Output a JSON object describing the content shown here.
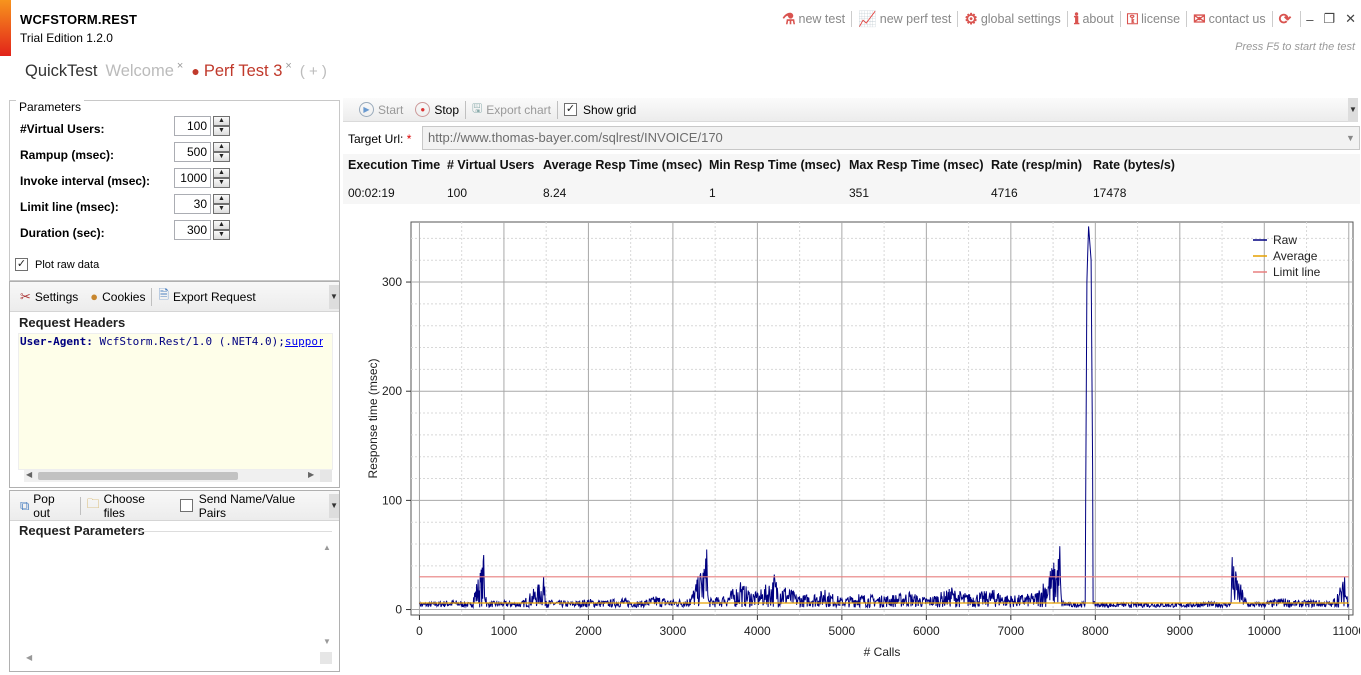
{
  "app": {
    "title": "WCFSTORM.REST",
    "edition": "Trial Edition 1.2.0",
    "hint": "Press F5 to start the test"
  },
  "menu": {
    "new_test": "new test",
    "new_perf_test": "new perf test",
    "global_settings": "global settings",
    "about": "about",
    "license": "license",
    "contact_us": "contact us"
  },
  "tabs": {
    "quicktest": "QuickTest",
    "welcome": "Welcome",
    "perf_test": "Perf Test 3",
    "add": "( + )",
    "close_glyph": "×"
  },
  "parameters": {
    "title": "Parameters",
    "items": [
      {
        "label": "#Virtual Users:",
        "value": "100"
      },
      {
        "label": "Rampup (msec):",
        "value": "500"
      },
      {
        "label": "Invoke interval (msec):",
        "value": "1000"
      },
      {
        "label": "Limit line (msec):",
        "value": "30"
      },
      {
        "label": "Duration (sec):",
        "value": "300"
      }
    ],
    "plot_raw_label": "Plot raw data",
    "plot_raw_checked": true
  },
  "headers_panel": {
    "settings": "Settings",
    "cookies": "Cookies",
    "export_request": "Export Request",
    "title": "Request Headers",
    "header_key": "User-Agent:",
    "header_value": " WcfStorm.Rest/1.0 (.NET4.0);",
    "header_link": "support"
  },
  "params_panel": {
    "pop_out": "Pop out",
    "choose_files": "Choose files",
    "send_pairs": "Send Name/Value Pairs",
    "title": "Request Parameters"
  },
  "run_toolbar": {
    "start": "Start",
    "stop": "Stop",
    "export_chart": "Export chart",
    "show_grid": "Show grid",
    "show_grid_checked": true
  },
  "target": {
    "label": "Target Url:",
    "required_mark": "*",
    "url": "http://www.thomas-bayer.com/sqlrest/INVOICE/170"
  },
  "stats": {
    "headers": [
      "Execution Time",
      "# Virtual Users",
      "Average Resp Time (msec)",
      "Min Resp Time (msec)",
      "Max Resp Time (msec)",
      "Rate (resp/min)",
      "Rate (bytes/s)"
    ],
    "values": [
      "00:02:19",
      "100",
      "8.24",
      "1",
      "351",
      "4716",
      "17478"
    ]
  },
  "colors": {
    "raw": "#000080",
    "average": "#e6a100",
    "limit": "#e87f7f",
    "accent": "#c0392b"
  },
  "chart_data": {
    "type": "line",
    "xlabel": "# Calls",
    "ylabel": "Response time (msec)",
    "xlim": [
      -100,
      11050
    ],
    "ylim": [
      -5,
      355
    ],
    "xticks": [
      0,
      1000,
      2000,
      3000,
      4000,
      5000,
      6000,
      7000,
      8000,
      9000,
      10000,
      11000
    ],
    "yticks": [
      0,
      100,
      200,
      300
    ],
    "grid": true,
    "legend_position": "top-right",
    "series": [
      {
        "name": "Raw",
        "color": "#000080",
        "x": [
          0,
          200,
          400,
          600,
          760,
          800,
          1000,
          1200,
          1470,
          1500,
          1800,
          2000,
          2200,
          2400,
          2600,
          2800,
          3000,
          3200,
          3400,
          3420,
          3600,
          3800,
          4000,
          4200,
          4500,
          4800,
          5000,
          5200,
          5500,
          5800,
          6000,
          6300,
          6500,
          6800,
          7000,
          7300,
          7580,
          7600,
          7700,
          7880,
          7900,
          7920,
          7950,
          7980,
          8100,
          8300,
          8600,
          9000,
          9300,
          9600,
          9620,
          9800,
          10000,
          10200,
          10400,
          10600,
          10800,
          10950,
          11000
        ],
        "y": [
          5,
          6,
          8,
          5,
          50,
          6,
          7,
          5,
          30,
          8,
          6,
          9,
          7,
          10,
          6,
          12,
          8,
          10,
          55,
          9,
          12,
          25,
          15,
          32,
          12,
          18,
          10,
          14,
          12,
          16,
          10,
          20,
          14,
          18,
          12,
          15,
          58,
          8,
          5,
          6,
          300,
          351,
          320,
          6,
          4,
          5,
          5,
          4,
          6,
          5,
          48,
          5,
          6,
          10,
          7,
          8,
          6,
          30,
          5
        ]
      },
      {
        "name": "Average",
        "color": "#e6a100",
        "x": [
          0,
          11000
        ],
        "y": [
          6,
          6
        ]
      },
      {
        "name": "Limit line",
        "color": "#e87f7f",
        "x": [
          0,
          11000
        ],
        "y": [
          30,
          30
        ]
      }
    ]
  }
}
